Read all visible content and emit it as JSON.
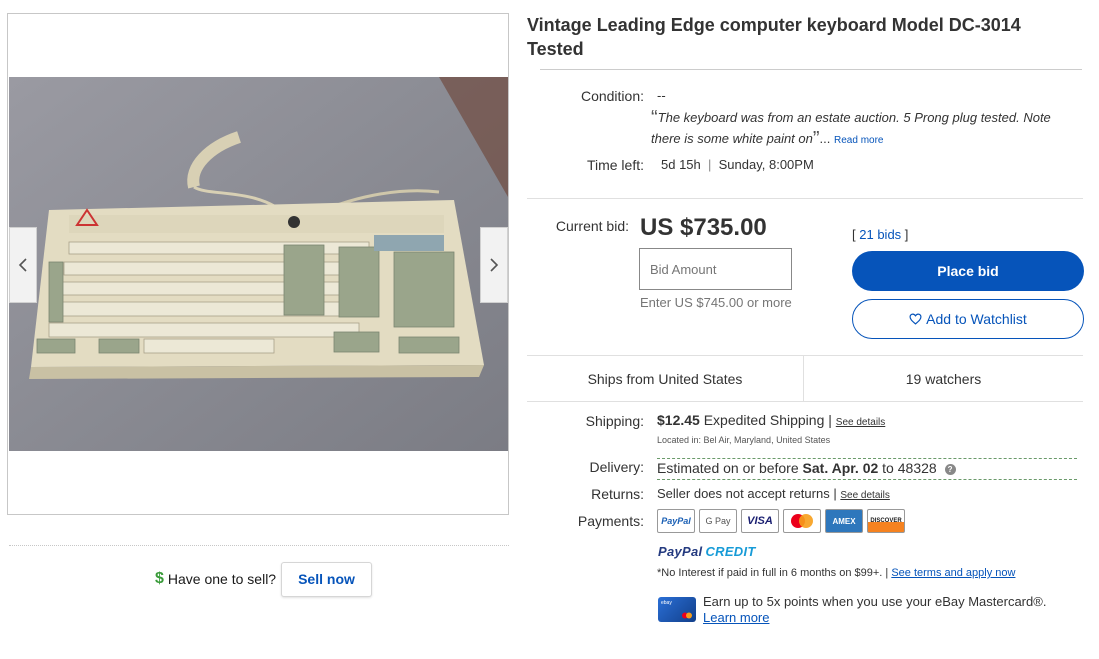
{
  "listing": {
    "title": "Vintage Leading Edge computer keyboard Model DC-3014 Tested"
  },
  "gallery": {
    "prev_icon": "chevron-left-icon",
    "next_icon": "chevron-right-icon"
  },
  "sell": {
    "text": "Have one to sell?",
    "button": "Sell now"
  },
  "condition": {
    "label": "Condition:",
    "value": "--",
    "description": "The keyboard was from an estate auction. 5 Prong plug tested. Note there is some white paint on",
    "ellipsis": "...",
    "read_more": "Read more"
  },
  "time_left": {
    "label": "Time left:",
    "value": "5d 15h",
    "separator": "|",
    "end": "Sunday, 8:00PM"
  },
  "bid": {
    "label": "Current bid:",
    "price": "US $735.00",
    "bids_open": "[",
    "bids": "21 bids",
    "bids_close": "]",
    "input_placeholder": "Bid Amount",
    "hint": "Enter US $745.00 or more",
    "place_bid": "Place bid",
    "watchlist": "Add to Watchlist"
  },
  "ships": {
    "from": "Ships from United States",
    "watchers": "19 watchers"
  },
  "shipping": {
    "label": "Shipping:",
    "price": "$12.45",
    "method": "Expedited Shipping",
    "separator": "|",
    "details": "See details",
    "location": "Located in: Bel Air, Maryland, United States"
  },
  "delivery": {
    "label": "Delivery:",
    "prefix": "Estimated on or before",
    "date": "Sat. Apr. 02",
    "to": "to",
    "zip": "48328",
    "help": "?"
  },
  "returns": {
    "label": "Returns:",
    "value": "Seller does not accept returns",
    "separator": "|",
    "details": "See details"
  },
  "payments": {
    "label": "Payments:",
    "methods": [
      "PayPal",
      "G Pay",
      "VISA",
      "Mastercard",
      "AMEX",
      "DISCOVER"
    ],
    "paypal_credit_1": "PayPal",
    "paypal_credit_2": "CREDIT",
    "terms": "*No Interest if paid in full in 6 months on $99+.",
    "terms_sep": "|",
    "terms_link": "See terms and apply now",
    "card_logo": "ebay",
    "mastercard_promo": "Earn up to 5x points when you use your eBay Mastercard®.",
    "learn_more": "Learn more"
  },
  "colors": {
    "accent": "#0654ba",
    "dollar": "#3a9b3a"
  }
}
